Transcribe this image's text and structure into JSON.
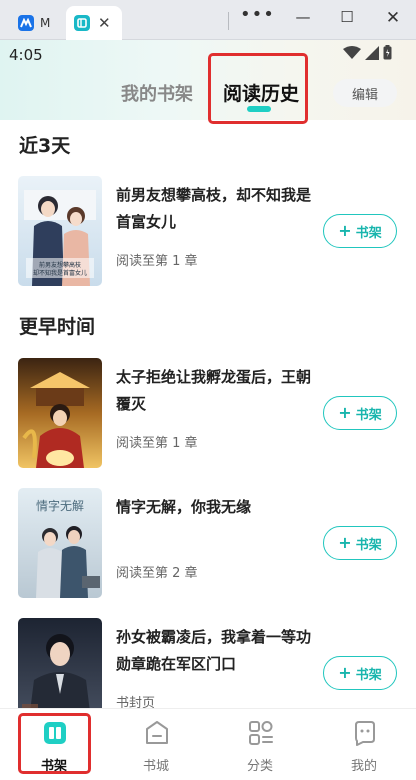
{
  "browser": {
    "tabs": [
      {
        "title": "M"
      },
      {
        "title": ""
      }
    ],
    "controls": {
      "more": "•••",
      "minimize": "—",
      "maximize": "☐",
      "close": "✕"
    }
  },
  "status_bar": {
    "time": "4:05"
  },
  "header": {
    "tabs": [
      {
        "label": "我的书架",
        "active": false
      },
      {
        "label": "阅读历史",
        "active": true
      }
    ],
    "edit_label": "编辑",
    "accent_color": "#1fcfc4"
  },
  "sections": [
    {
      "title": "近3天",
      "books": [
        {
          "title": "前男友想攀高枝，却不知我是首富女儿",
          "progress": "阅读至第 1 章",
          "add_label": "书架",
          "cover_text": "前男友想攀高枝却不知我是首富女儿"
        }
      ]
    },
    {
      "title": "更早时间",
      "books": [
        {
          "title": "太子拒绝让我孵龙蛋后，王朝覆灭",
          "progress": "阅读至第 1 章",
          "add_label": "书架",
          "cover_text": ""
        },
        {
          "title": "情字无解，你我无缘",
          "progress": "阅读至第 2 章",
          "add_label": "书架",
          "cover_text": "情字无解"
        },
        {
          "title": "孙女被霸凌后，我拿着一等功勋章跪在军区门口",
          "progress": "书封页",
          "add_label": "书架",
          "cover_text": ""
        }
      ]
    }
  ],
  "bottom_nav": [
    {
      "label": "书架",
      "icon": "bookshelf-icon",
      "active": true
    },
    {
      "label": "书城",
      "icon": "store-icon",
      "active": false
    },
    {
      "label": "分类",
      "icon": "category-grid-icon",
      "active": false
    },
    {
      "label": "我的",
      "icon": "profile-icon",
      "active": false
    }
  ]
}
